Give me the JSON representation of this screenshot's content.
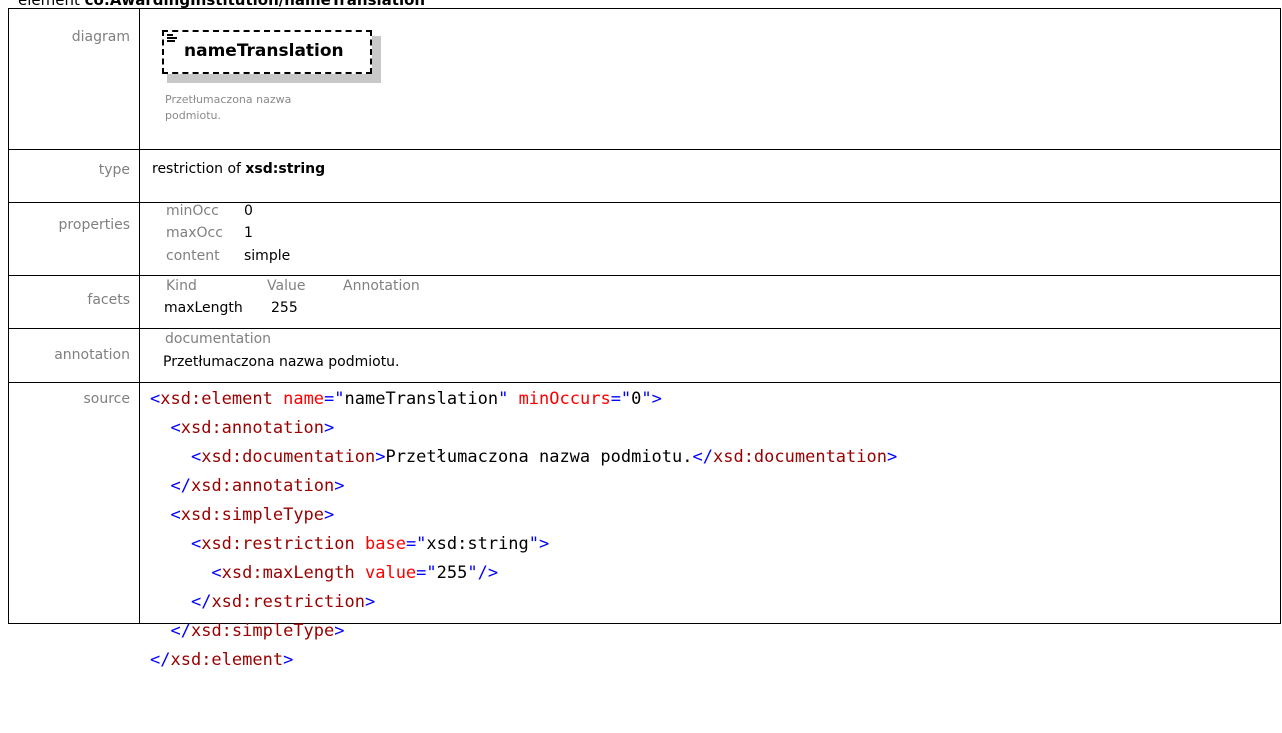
{
  "heading": {
    "prefix": "element ",
    "path": "co:AwardingInstitution/nameTranslation"
  },
  "rows": {
    "diagram": {
      "label": "diagram",
      "element_name": "nameTranslation",
      "documentation": "Przetłumaczona nazwa podmiotu."
    },
    "type": {
      "label": "type",
      "prefix": "restriction of ",
      "base": "xsd:string"
    },
    "properties": {
      "label": "properties",
      "items": [
        {
          "key": "minOcc",
          "value": "0"
        },
        {
          "key": "maxOcc",
          "value": "1"
        },
        {
          "key": "content",
          "value": "simple"
        }
      ]
    },
    "facets": {
      "label": "facets",
      "headers": {
        "kind": "Kind",
        "value": "Value",
        "annotation": "Annotation"
      },
      "row": {
        "kind": "maxLength",
        "value": "255"
      }
    },
    "annotation": {
      "label": "annotation",
      "title": "documentation",
      "text": "Przetłumaczona nazwa podmiotu."
    },
    "source": {
      "label": "source",
      "name_value": "nameTranslation",
      "min_occurs_value": "0",
      "documentation_text": "Przetłumaczona nazwa podmiotu.",
      "base_value": "xsd:string",
      "max_length_value": "255"
    }
  },
  "colors": {
    "tag": "#0000ff",
    "tag_name": "#990000",
    "attr": "#ff0000",
    "label": "#808080"
  }
}
